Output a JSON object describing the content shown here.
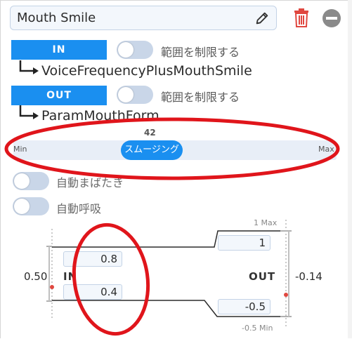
{
  "header": {
    "name_value": "Mouth Smile",
    "edit_icon": "pencil-icon",
    "delete_icon": "trash-icon",
    "collapse_icon": "minus-circle-icon"
  },
  "input": {
    "button_label": "IN",
    "clamp_label": "範囲を制限する",
    "clamp_on": false,
    "parameter": "VoiceFrequencyPlusMouthSmile"
  },
  "output": {
    "button_label": "OUT",
    "clamp_label": "範囲を制限する",
    "clamp_on": false,
    "parameter": "ParamMouthForm"
  },
  "smoothing": {
    "value": "42",
    "thumb_label": "スムージング",
    "min_label": "Min",
    "max_label": "Max"
  },
  "auto_blink": {
    "label": "自動まばたき",
    "on": false
  },
  "auto_breath": {
    "label": "自動呼吸",
    "on": false
  },
  "mapping": {
    "in_label": "IN",
    "out_label": "OUT",
    "in_current": "0.50",
    "out_current": "-0.14",
    "in_max": "0.8",
    "in_min": "0.4",
    "out_max": "1",
    "out_min": "-0.5",
    "out_max_caption": "1 Max",
    "out_min_caption": "-0.5 Min"
  },
  "colors": {
    "accent": "#1a8ff0",
    "toggle_off": "#c9d6e8",
    "delete": "#e0473f",
    "annotation": "#e0151b"
  }
}
